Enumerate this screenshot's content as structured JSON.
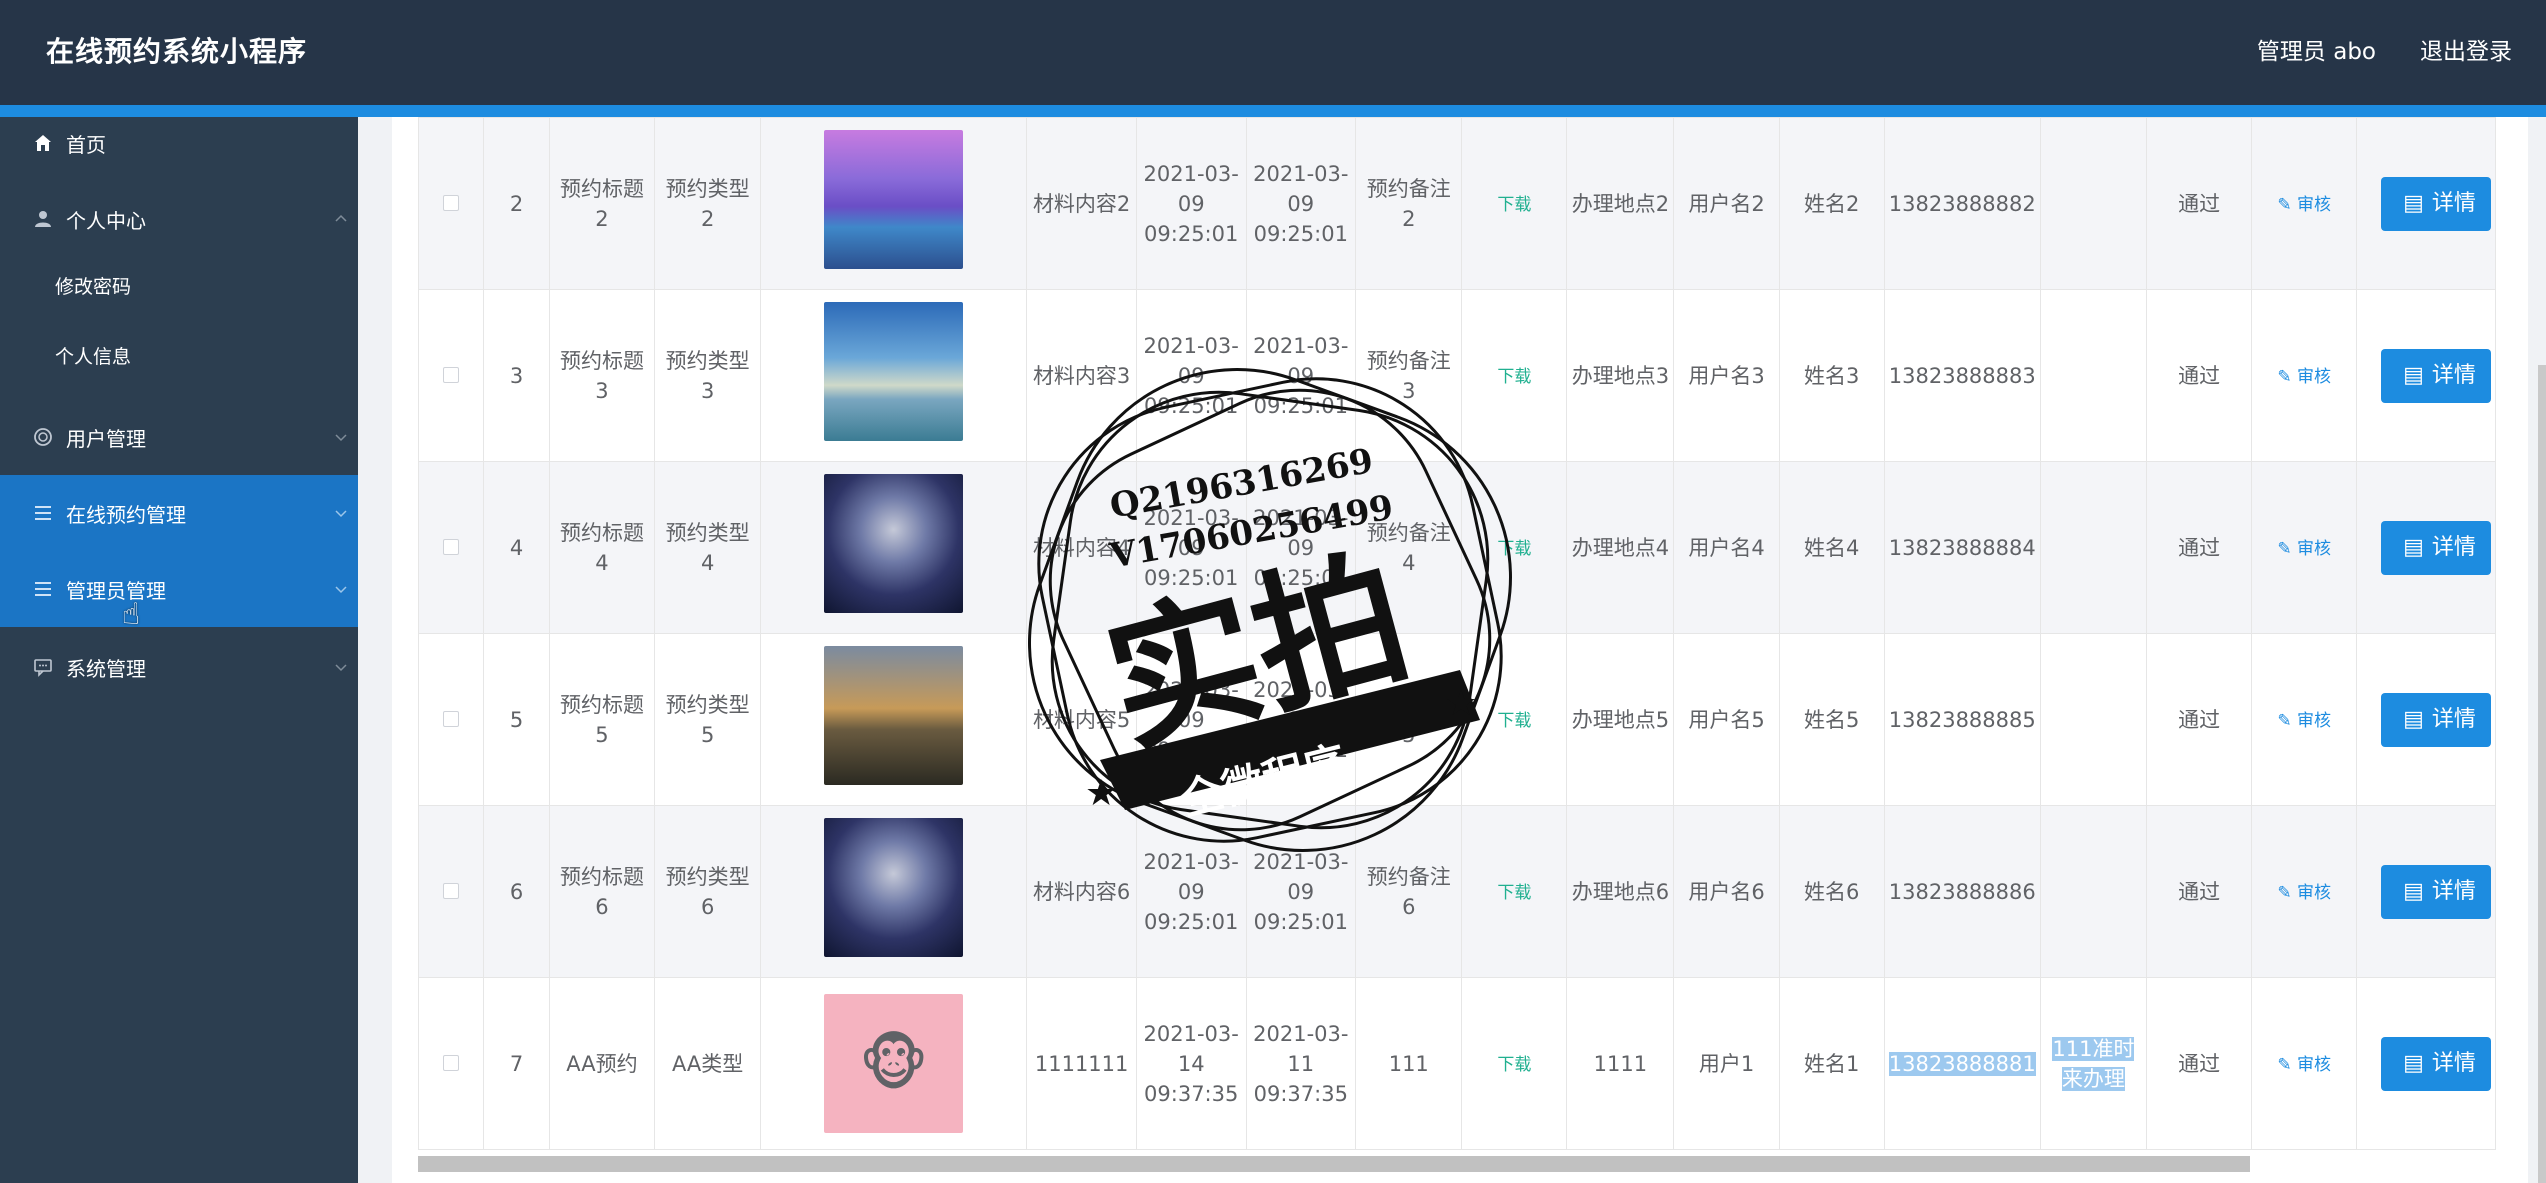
{
  "header": {
    "title": "在线预约系统小程序",
    "user": "管理员 abo",
    "logout": "退出登录"
  },
  "sidebar": {
    "items": [
      {
        "label": "首页",
        "icon": "home-icon"
      },
      {
        "label": "个人中心",
        "icon": "user-icon"
      },
      {
        "label": "修改密码"
      },
      {
        "label": "个人信息"
      },
      {
        "label": "用户管理",
        "icon": "users-icon"
      },
      {
        "label": "在线预约管理",
        "icon": "list-icon"
      },
      {
        "label": "管理员管理",
        "icon": "list-icon"
      },
      {
        "label": "系统管理",
        "icon": "chat-icon"
      }
    ]
  },
  "table": {
    "rows": [
      {
        "no": "2",
        "title": "预约标题2",
        "type": "预约类型2",
        "material": "材料内容2",
        "start": "2021-03-09 09:25:01",
        "end": "2021-03-09 09:25:01",
        "remark": "预约备注2",
        "download": "下载",
        "place": "办理地点2",
        "username": "用户名2",
        "name": "姓名2",
        "phone": "13823888882",
        "reply": "",
        "status": "通过",
        "audit": "审核",
        "detail": "详情"
      },
      {
        "no": "3",
        "title": "预约标题3",
        "type": "预约类型3",
        "material": "材料内容3",
        "start": "2021-03-09 09:25:01",
        "end": "2021-03-09 09:25:01",
        "remark": "预约备注3",
        "download": "下载",
        "place": "办理地点3",
        "username": "用户名3",
        "name": "姓名3",
        "phone": "13823888883",
        "reply": "",
        "status": "通过",
        "audit": "审核",
        "detail": "详情"
      },
      {
        "no": "4",
        "title": "预约标题4",
        "type": "预约类型4",
        "material": "材料内容4",
        "start": "2021-03-09 09:25:01",
        "end": "2021-03-09 09:25:01",
        "remark": "预约备注4",
        "download": "下载",
        "place": "办理地点4",
        "username": "用户名4",
        "name": "姓名4",
        "phone": "13823888884",
        "reply": "",
        "status": "通过",
        "audit": "审核",
        "detail": "详情"
      },
      {
        "no": "5",
        "title": "预约标题5",
        "type": "预约类型5",
        "material": "材料内容5",
        "start": "2021-03-09 09:25:01",
        "end": "2021-03-09 09:25:01",
        "remark": "预约备注5",
        "download": "下载",
        "place": "办理地点5",
        "username": "用户名5",
        "name": "姓名5",
        "phone": "13823888885",
        "reply": "",
        "status": "通过",
        "audit": "审核",
        "detail": "详情"
      },
      {
        "no": "6",
        "title": "预约标题6",
        "type": "预约类型6",
        "material": "材料内容6",
        "start": "2021-03-09 09:25:01",
        "end": "2021-03-09 09:25:01",
        "remark": "预约备注6",
        "download": "下载",
        "place": "办理地点6",
        "username": "用户名6",
        "name": "姓名6",
        "phone": "13823888886",
        "reply": "",
        "status": "通过",
        "audit": "审核",
        "detail": "详情"
      },
      {
        "no": "7",
        "title": "AA预约",
        "type": "AA类型",
        "material": "1111111",
        "start": "2021-03-14 09:37:35",
        "end": "2021-03-11 09:37:35",
        "remark": "111",
        "download": "下载",
        "place": "1111",
        "username": "用户1",
        "name": "姓名1",
        "phone": "13823888881",
        "reply": "111准时来办理",
        "status": "通过",
        "audit": "审核",
        "detail": "详情"
      }
    ]
  },
  "watermark": {
    "contact1": "Q2196316269",
    "contact2": "V17060256499",
    "main": "实拍",
    "banner": "全微程序"
  },
  "colors": {
    "header": "#263548",
    "sidebar": "#2c3e50",
    "accent": "#1d8ce0",
    "download": "#20b090"
  }
}
